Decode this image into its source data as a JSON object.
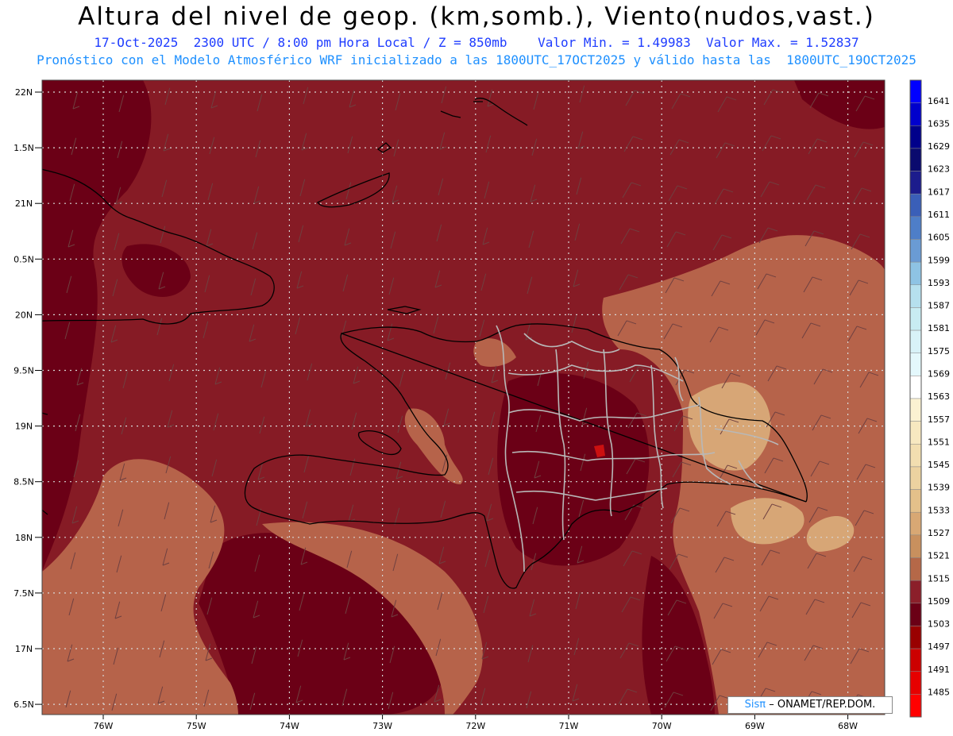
{
  "title": "Altura del nivel de geop. (km,somb.), Viento(nudos,vast.)",
  "subtitle_line1": "17-Oct-2025  2300 UTC / 8:00 pm Hora Local / Z = 850mb    Valor Min. = 1.49983  Valor Max. = 1.52837",
  "subtitle_line2": "Pronóstico con el Modelo Atmosférico WRF inicializado a las 1800UTC_17OCT2025 y válido hasta las  1800UTC_19OCT2025",
  "lat_labels": [
    "22N",
    "1.5N",
    "21N",
    "0.5N",
    "20N",
    "9.5N",
    "19N",
    "8.5N",
    "18N",
    "7.5N",
    "17N",
    "6.5N"
  ],
  "lon_labels": [
    "76W",
    "75W",
    "74W",
    "73W",
    "72W",
    "71W",
    "70W",
    "69W",
    "68W"
  ],
  "colorbar": {
    "levels": [
      1641,
      1635,
      1629,
      1623,
      1617,
      1611,
      1605,
      1599,
      1593,
      1587,
      1581,
      1575,
      1569,
      1563,
      1557,
      1551,
      1545,
      1539,
      1533,
      1527,
      1521,
      1515,
      1509,
      1503,
      1497,
      1491,
      1485
    ],
    "colors": [
      "#0000ff",
      "#0000cc",
      "#00008b",
      "#0a0a6e",
      "#1c1c8c",
      "#3a5fb8",
      "#4e7ec8",
      "#6a9bd4",
      "#8ec3e4",
      "#b6e0ee",
      "#c8ecf2",
      "#d8f2f8",
      "#e4f8fc",
      "#ffffff",
      "#fbf2d2",
      "#f7e8c0",
      "#f2deb0",
      "#ecd2a0",
      "#e4c08a",
      "#d8a874",
      "#c8905e",
      "#b56848",
      "#8b1f2a",
      "#6b0016",
      "#990000",
      "#cc0000",
      "#e60000",
      "#ff0000"
    ]
  },
  "map_colors": {
    "base": "#861b25",
    "dark": "#6b0016",
    "light": "#b6634a",
    "lighter": "#d7a676",
    "boundary": "#000000",
    "provinces": "#b8b8b8",
    "grid": "#d8d8d8",
    "barbs": "#6f4040"
  },
  "credit": {
    "brand": "Sisπ",
    "text": "– ONAMET/REP.DOM."
  }
}
